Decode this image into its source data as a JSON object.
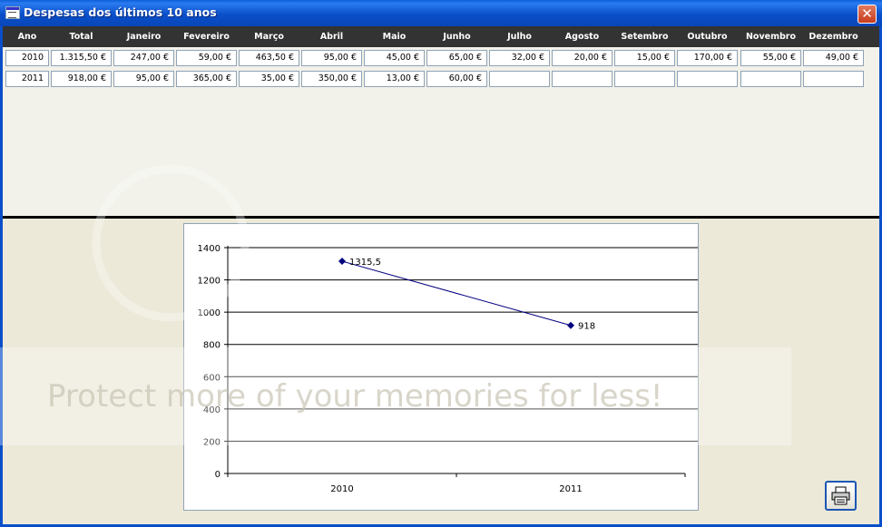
{
  "window": {
    "title": "Despesas dos últimos 10 anos",
    "close_label": "✕"
  },
  "table": {
    "columns": [
      "Ano",
      "Total",
      "Janeiro",
      "Fevereiro",
      "Março",
      "Abril",
      "Maio",
      "Junho",
      "Julho",
      "Agosto",
      "Setembro",
      "Outubro",
      "Novembro",
      "Dezembro"
    ],
    "rows": [
      [
        "2010",
        "1.315,50 €",
        "247,00 €",
        "59,00 €",
        "463,50 €",
        "95,00 €",
        "45,00 €",
        "65,00 €",
        "32,00 €",
        "20,00 €",
        "15,00 €",
        "170,00 €",
        "55,00 €",
        "49,00 €"
      ],
      [
        "2011",
        "918,00 €",
        "95,00 €",
        "365,00 €",
        "35,00 €",
        "350,00 €",
        "13,00 €",
        "60,00 €",
        "",
        "",
        "",
        "",
        "",
        ""
      ]
    ]
  },
  "chart_data": {
    "type": "line",
    "categories": [
      "2010",
      "2011"
    ],
    "series": [
      {
        "values": [
          1315.5,
          918
        ],
        "data_labels": [
          "1315,5",
          "918"
        ],
        "color": "#000080"
      }
    ],
    "y_ticks": [
      "0",
      "200",
      "400",
      "600",
      "800",
      "1000",
      "1200",
      "1400"
    ],
    "ylim": [
      0,
      1400
    ],
    "grid": true,
    "legend": "none"
  },
  "watermark": {
    "text": "Protect more of your memories for less!"
  },
  "print_button": {
    "icon": "printer-icon"
  }
}
